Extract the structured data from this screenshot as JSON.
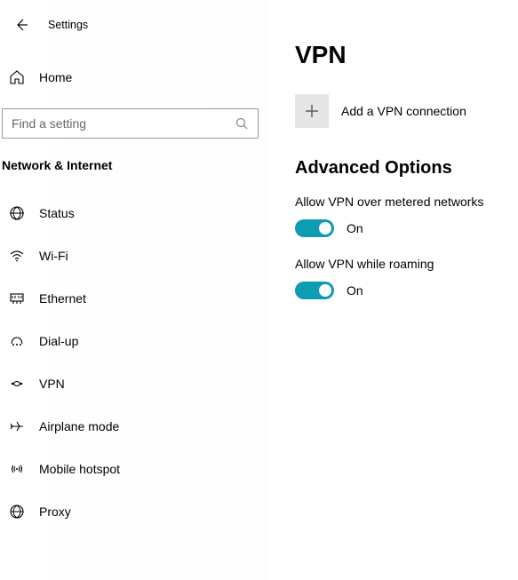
{
  "header": {
    "appTitle": "Settings"
  },
  "sidebar": {
    "home": {
      "label": "Home",
      "icon": "home-icon"
    },
    "search": {
      "placeholder": "Find a setting"
    },
    "categoryTitle": "Network & Internet",
    "items": [
      {
        "label": "Status",
        "icon": "status-icon"
      },
      {
        "label": "Wi-Fi",
        "icon": "wifi-icon"
      },
      {
        "label": "Ethernet",
        "icon": "ethernet-icon"
      },
      {
        "label": "Dial-up",
        "icon": "dialup-icon"
      },
      {
        "label": "VPN",
        "icon": "vpn-icon"
      },
      {
        "label": "Airplane mode",
        "icon": "airplane-icon"
      },
      {
        "label": "Mobile hotspot",
        "icon": "hotspot-icon"
      },
      {
        "label": "Proxy",
        "icon": "proxy-icon"
      }
    ]
  },
  "main": {
    "title": "VPN",
    "addAction": {
      "label": "Add a VPN connection"
    },
    "advanced": {
      "title": "Advanced Options",
      "options": [
        {
          "label": "Allow VPN over metered networks",
          "state": "On",
          "on": true
        },
        {
          "label": "Allow VPN while roaming",
          "state": "On",
          "on": true
        }
      ]
    }
  },
  "colors": {
    "accent": "#0e9cb3",
    "tileGray": "#e6e6e6"
  }
}
